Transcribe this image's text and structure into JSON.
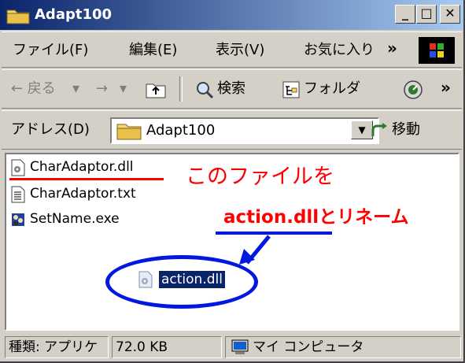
{
  "window": {
    "title": "Adapt100"
  },
  "title_buttons": {
    "minimize": "_",
    "maximize": "□",
    "close": "✕"
  },
  "menu": {
    "items": [
      "ファイル(F)",
      "編集(E)",
      "表示(V)",
      "お気に入り"
    ],
    "overflow": "»"
  },
  "toolbar": {
    "back": "← 戻る",
    "forward": "→",
    "search": "検索",
    "folders": "フォルダ",
    "overflow": "»"
  },
  "address": {
    "label": "アドレス(D)",
    "value": "Adapt100",
    "go": "移動"
  },
  "files": [
    {
      "name": "CharAdaptor.dll",
      "icon": "dll-file-icon"
    },
    {
      "name": "CharAdaptor.txt",
      "icon": "text-file-icon"
    },
    {
      "name": "SetName.exe",
      "icon": "exe-file-icon"
    }
  ],
  "annotation": {
    "line1": "このファイルを",
    "line2": "action.dllとリネーム",
    "color": "#ff0000",
    "mark_color": "#0018e0"
  },
  "selected_file": {
    "name": "action.dll",
    "icon": "dll-file-icon"
  },
  "status": {
    "type": "種類: アプリケ",
    "size": "72.0 KB",
    "zone": "マイ コンピュータ"
  }
}
